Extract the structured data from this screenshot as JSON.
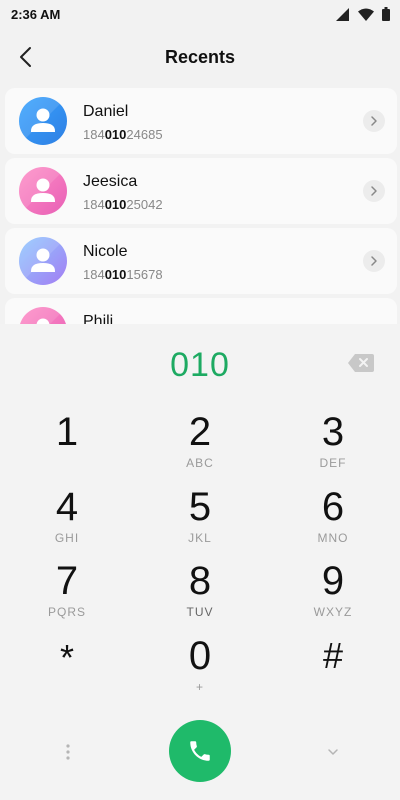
{
  "status_bar": {
    "time": "2:36 AM",
    "icons": [
      "signal-icon",
      "wifi-icon",
      "battery-icon"
    ]
  },
  "header": {
    "title": "Recents",
    "back_icon": "back-arrow-icon"
  },
  "recents": [
    {
      "name": "Daniel",
      "number_prefix": "184",
      "number_match": "010",
      "number_suffix": "24685",
      "avatar_color": "#3a9bf5"
    },
    {
      "name": "Jeesica",
      "number_prefix": "184",
      "number_match": "010",
      "number_suffix": "25042",
      "avatar_color": "#ef6fbd"
    },
    {
      "name": "Nicole",
      "number_prefix": "184",
      "number_match": "010",
      "number_suffix": "15678",
      "avatar_color": "#8aa9ff"
    },
    {
      "name": "Phili",
      "number_prefix": "",
      "number_match": "",
      "number_suffix": "",
      "avatar_color": "#ef6fbd"
    }
  ],
  "dialer": {
    "input": "010",
    "keys": [
      {
        "digit": "1",
        "letters": ""
      },
      {
        "digit": "2",
        "letters": "ABC"
      },
      {
        "digit": "3",
        "letters": "DEF"
      },
      {
        "digit": "4",
        "letters": "GHI"
      },
      {
        "digit": "5",
        "letters": "JKL"
      },
      {
        "digit": "6",
        "letters": "MNO"
      },
      {
        "digit": "7",
        "letters": "PQRS"
      },
      {
        "digit": "8",
        "letters": "TUV"
      },
      {
        "digit": "9",
        "letters": "WXYZ"
      },
      {
        "digit": "*",
        "letters": ""
      },
      {
        "digit": "0",
        "letters": "+"
      },
      {
        "digit": "#",
        "letters": ""
      }
    ]
  },
  "colors": {
    "accent": "#1daa62",
    "call_button": "#1fba6a"
  }
}
